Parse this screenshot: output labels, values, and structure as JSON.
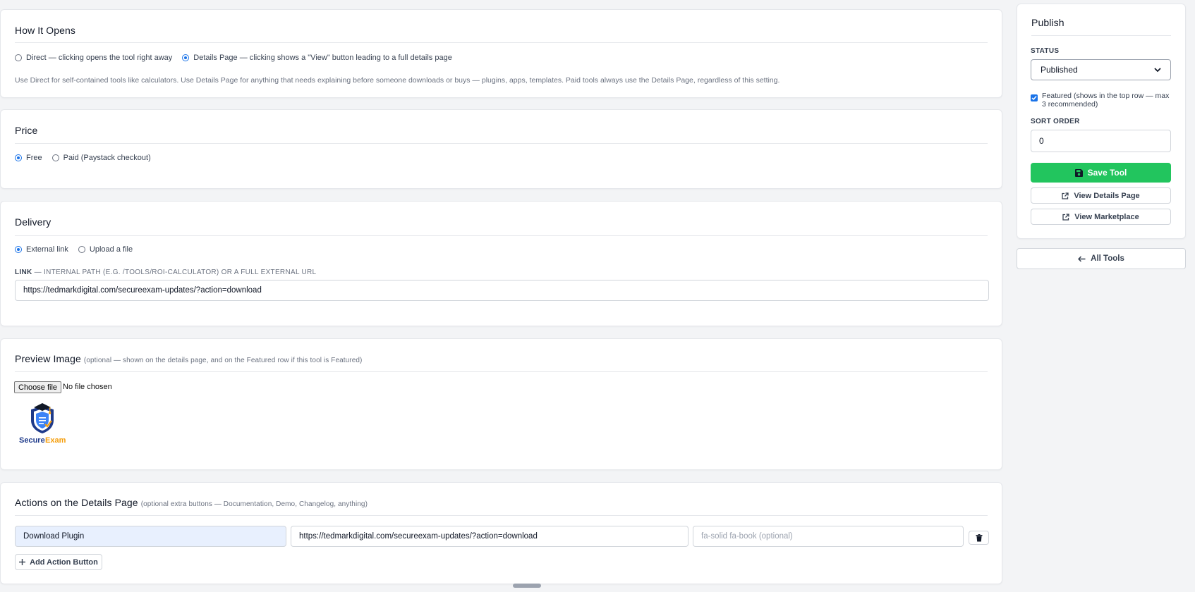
{
  "how_it_opens": {
    "title": "How It Opens",
    "options": [
      "Direct — clicking opens the tool right away",
      "Details Page — clicking shows a \"View\" button leading to a full details page"
    ],
    "selected": 1,
    "help": "Use Direct for self-contained tools like calculators. Use Details Page for anything that needs explaining before someone downloads or buys — plugins, apps, templates. Paid tools always use the Details Page, regardless of this setting."
  },
  "price": {
    "title": "Price",
    "options": [
      "Free",
      "Paid (Paystack checkout)"
    ],
    "selected": 0
  },
  "delivery": {
    "title": "Delivery",
    "options": [
      "External link",
      "Upload a file"
    ],
    "selected": 0,
    "link_label": "LINK",
    "link_hint": " — INTERNAL PATH (E.G. /TOOLS/ROI-CALCULATOR) OR A FULL EXTERNAL URL",
    "link_value": "https://tedmarkdigital.com/secureexam-updates/?action=download"
  },
  "preview_image": {
    "title": "Preview Image",
    "note": "(optional — shown on the details page, and on the Featured row if this tool is Featured)",
    "choose_file": "Choose file",
    "file_status": "No file chosen",
    "logo_text_1": "Secure",
    "logo_text_2": "Exam"
  },
  "actions": {
    "title": "Actions on the Details Page",
    "note": "(optional extra buttons — Documentation, Demo, Changelog, anything)",
    "row": {
      "label_value": "Download Plugin",
      "url_value": "https://tedmarkdigital.com/secureexam-updates/?action=download",
      "icon_placeholder": "fa-solid fa-book (optional)"
    },
    "add_button": "Add Action Button"
  },
  "publish": {
    "title": "Publish",
    "status_label": "STATUS",
    "status_value": "Published",
    "featured_label": "Featured (shows in the top row — max 3 recommended)",
    "sort_label": "SORT ORDER",
    "sort_value": "0",
    "save": "Save Tool",
    "view_details": "View Details Page",
    "view_marketplace": "View Marketplace"
  },
  "all_tools": "All Tools",
  "colors": {
    "accent": "#1a73e8",
    "save_green": "#22c55e",
    "highlight": "#e8f0fe"
  }
}
